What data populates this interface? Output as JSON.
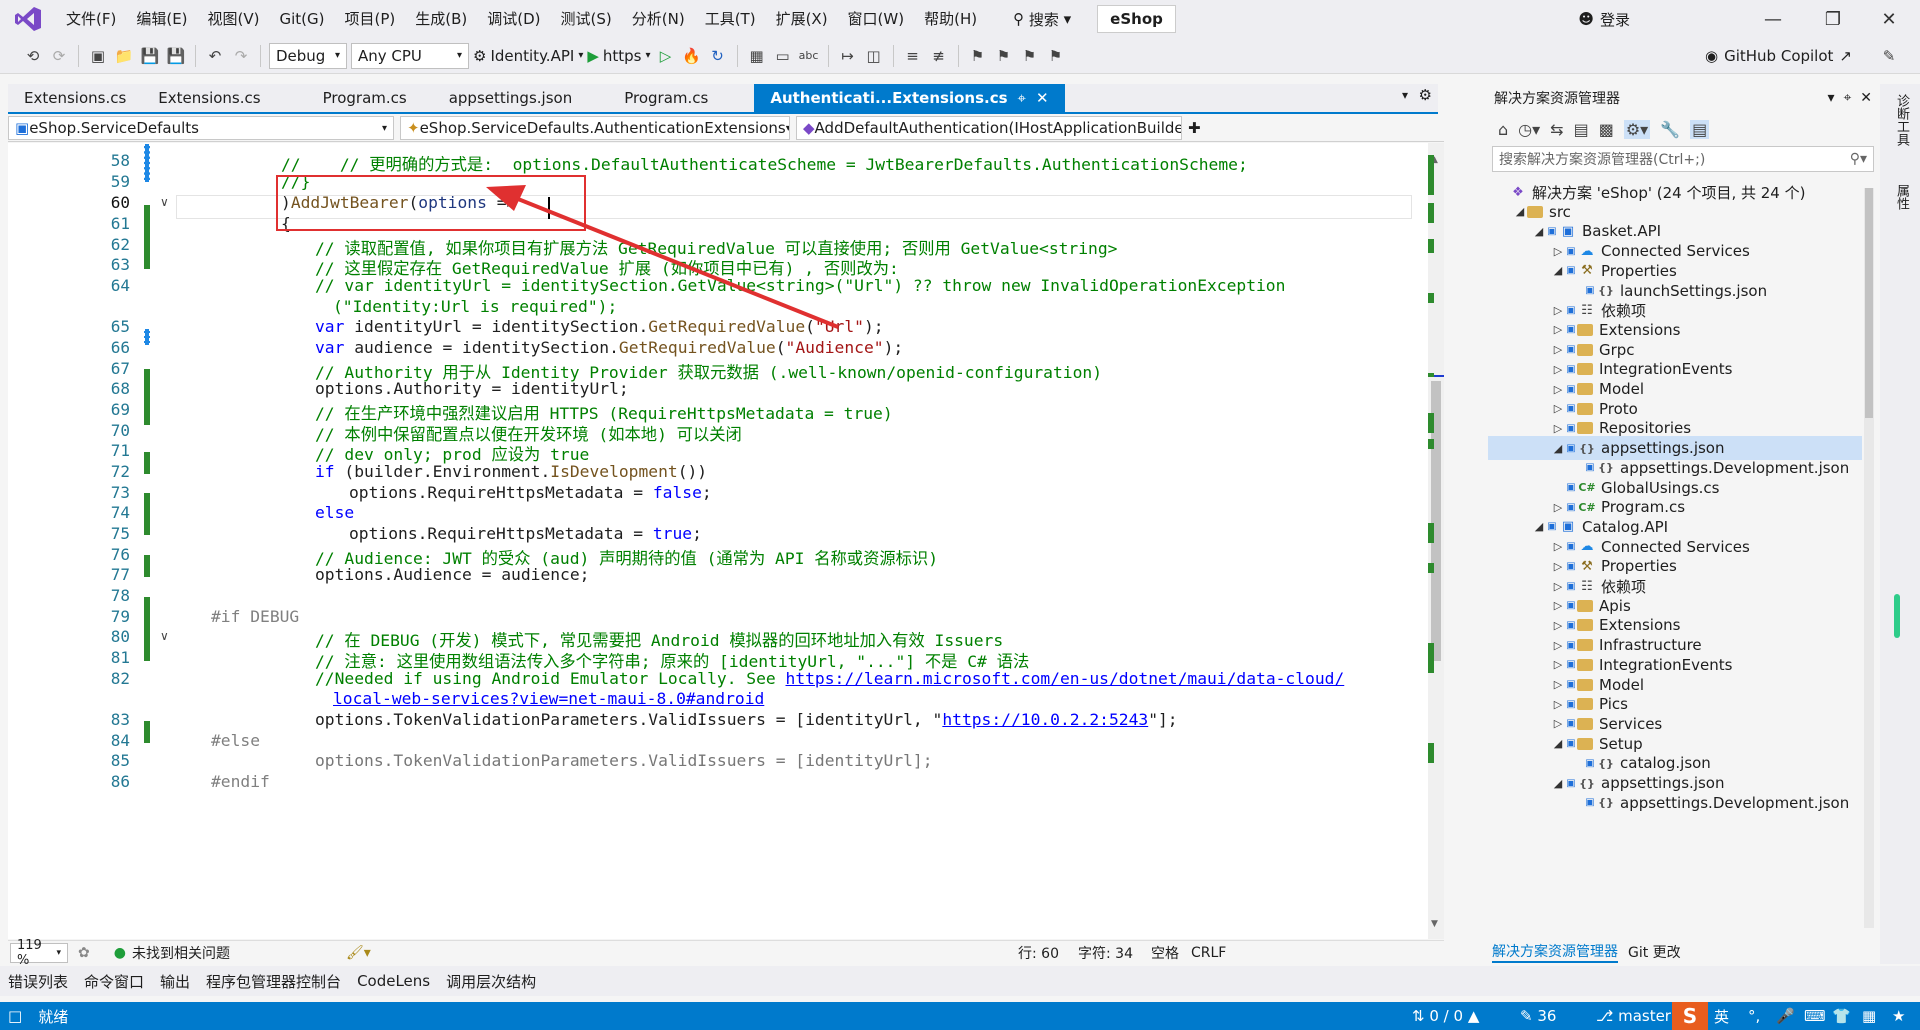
{
  "menu": {
    "items": [
      "文件(F)",
      "编辑(E)",
      "视图(V)",
      "Git(G)",
      "项目(P)",
      "生成(B)",
      "调试(D)",
      "测试(S)",
      "分析(N)",
      "工具(T)",
      "扩展(X)",
      "窗口(W)",
      "帮助(H)"
    ],
    "search": "搜索",
    "solution": "eShop",
    "login": "登录"
  },
  "toolbar": {
    "config": "Debug",
    "platform": "Any CPU",
    "startup": "Identity.API",
    "profile": "https",
    "copilot": "GitHub Copilot"
  },
  "tabs": [
    {
      "label": "Extensions.cs"
    },
    {
      "label": "Extensions.cs"
    },
    {
      "label": "Program.cs"
    },
    {
      "label": "appsettings.json"
    },
    {
      "label": "Program.cs"
    },
    {
      "label": "Authenticati...Extensions.cs"
    }
  ],
  "nav": {
    "project": "eShop.ServiceDefaults",
    "type": "eShop.ServiceDefaults.AuthenticationExtensions",
    "member": "AddDefaultAuthentication(IHostApplicationBuilder builder)"
  },
  "line_numbers": [
    "58",
    "59",
    "60",
    "61",
    "62",
    "63",
    "64",
    "",
    "65",
    "66",
    "67",
    "68",
    "69",
    "70",
    "71",
    "72",
    "73",
    "74",
    "75",
    "76",
    "77",
    "78",
    "79",
    "80",
    "81",
    "82",
    "",
    "83",
    "84",
    "85",
    "86"
  ],
  "code": {
    "l58": "//    // 更明确的方式是:  options.DefaultAuthenticateScheme = JwtBearerDefaults.AuthenticationScheme;",
    "l59": "//}",
    "l60a": ")",
    ".": ".",
    "l60m": "AddJwtBearer",
    "l60b": "(",
    "l60c": "options",
    "l60d": " =>",
    "l61": "{",
    "l62": "// 读取配置值, 如果你项目有扩展方法 GetRequiredValue 可以直接使用; 否则用 GetValue<string>",
    "l63": "// 这里假定存在 GetRequiredValue 扩展 (如你项目中已有) , 否则改为:",
    "l64a": "// var identityUrl = identitySection.GetValue<string>(\"Url\") ?? throw new InvalidOperationException",
    "l64b": "(\"Identity:Url is required\");",
    "l65k": "var",
    "l65v": " identityUrl = identitySection.",
    "l65m": "GetRequiredValue",
    "l65s": "\"Url\"",
    "l65e": ");",
    "l66k": "var",
    "l66v": " audience = identitySection.",
    "l66m": "GetRequiredValue",
    "l66s": "\"Audience\"",
    "l66e": ");",
    "l67": "// Authority 用于从 Identity Provider 获取元数据 (.well-known/openid-configuration)",
    "l68": "options.Authority = identityUrl;",
    "l69": "// 在生产环境中强烈建议启用 HTTPS (RequireHttpsMetadata = true)",
    "l70": "// 本例中保留配置点以便在开发环境 (如本地) 可以关闭",
    "l71": "// dev only; prod 应设为 true",
    "l72k": "if",
    "l72a": " (builder.Environment.",
    "l72m": "IsDevelopment",
    "l72b": "())",
    "l73a": "options.RequireHttpsMetadata = ",
    "l73k": "false",
    "l73b": ";",
    "l74": "else",
    "l75a": "options.RequireHttpsMetadata = ",
    "l75k": "true",
    "l75b": ";",
    "l76": "// Audience: JWT 的受众 (aud) 声明期待的值 (通常为 API 名称或资源标识)",
    "l77": "options.Audience = audience;",
    "l79": "#if DEBUG",
    "l80": "// 在 DEBUG (开发) 模式下, 常见需要把 Android 模拟器的回环地址加入有效 Issuers",
    "l81": "// 注意: 这里使用数组语法传入多个字符串; 原来的 [identityUrl, \"...\"] 不是 C# 语法",
    "l82a": "//Needed if using Android Emulator Locally. See ",
    "l82l": "https://learn.microsoft.com/en-us/dotnet/maui/data-cloud/",
    "l82b": "local-web-services?view=net-maui-8.0#android",
    "l83a": "options.TokenValidationParameters.ValidIssuers = [identityUrl, \"",
    "l83l": "https://10.0.2.2:5243",
    "l83b": "\"];",
    "l84": "#else",
    "l85": "options.TokenValidationParameters.ValidIssuers = [identityUrl];",
    "l86": "#endif"
  },
  "editor_status": {
    "zoom": "119 %",
    "issues": "未找到相关问题",
    "line": "行: 60",
    "char": "字符: 34",
    "spaces": "空格",
    "eol": "CRLF"
  },
  "bottom_tabs": [
    "错误列表",
    "命令窗口",
    "输出",
    "程序包管理器控制台",
    "CodeLens",
    "调用层次结构"
  ],
  "status": {
    "ready": "就绪",
    "sync": "0 / 0",
    "edits": "36",
    "branch": "master",
    "ime": "英"
  },
  "solution_explorer": {
    "title": "解决方案资源管理器",
    "search": "搜索解决方案资源管理器(Ctrl+;)",
    "tabs": [
      "解决方案资源管理器",
      "Git 更改"
    ],
    "nodes": [
      {
        "label": "解决方案 'eShop' (24 个项目, 共 24 个)"
      },
      {
        "label": "src"
      },
      {
        "label": "Basket.API"
      },
      {
        "label": "Connected Services"
      },
      {
        "label": "Properties"
      },
      {
        "label": "launchSettings.json"
      },
      {
        "label": "依赖项"
      },
      {
        "label": "Extensions"
      },
      {
        "label": "Grpc"
      },
      {
        "label": "IntegrationEvents"
      },
      {
        "label": "Model"
      },
      {
        "label": "Proto"
      },
      {
        "label": "Repositories"
      },
      {
        "label": "appsettings.json"
      },
      {
        "label": "appsettings.Development.json"
      },
      {
        "label": "GlobalUsings.cs"
      },
      {
        "label": "Program.cs"
      },
      {
        "label": "Catalog.API"
      },
      {
        "label": "Connected Services"
      },
      {
        "label": "Properties"
      },
      {
        "label": "依赖项"
      },
      {
        "label": "Apis"
      },
      {
        "label": "Extensions"
      },
      {
        "label": "Infrastructure"
      },
      {
        "label": "IntegrationEvents"
      },
      {
        "label": "Model"
      },
      {
        "label": "Pics"
      },
      {
        "label": "Services"
      },
      {
        "label": "Setup"
      },
      {
        "label": "catalog.json"
      },
      {
        "label": "appsettings.json"
      },
      {
        "label": "appsettings.Development.json"
      }
    ]
  },
  "right_rail": [
    "诊断工具",
    "属性"
  ],
  "colors": {
    "accent": "#007acc",
    "annotation": "#e03030",
    "change_green": "#2e8b2e"
  }
}
